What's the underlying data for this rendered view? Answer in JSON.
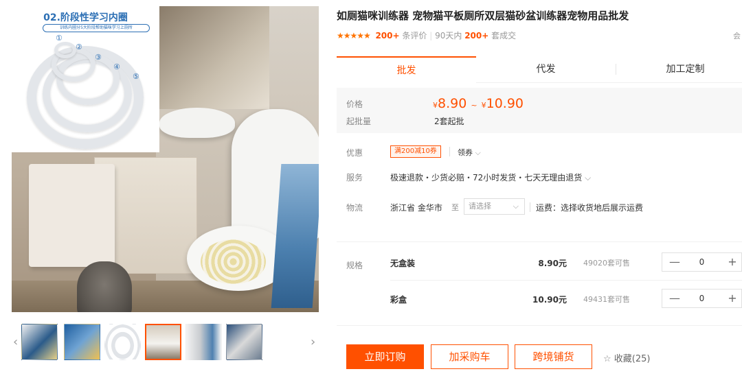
{
  "gallery": {
    "inset_title": "02.阶段性学习内圈",
    "inset_subtitle": "训练内圈分5大阶段帮助猫咪学习上厕所",
    "ring_numbers": [
      "①",
      "②",
      "③",
      "④",
      "⑤"
    ],
    "prev_icon": "‹",
    "next_icon": "›",
    "thumbnail_count": 6,
    "active_thumbnail": 4
  },
  "product": {
    "title": "如厕猫咪训练器 宠物猫平板厕所双层猫砂盆训练器宠物用品批发",
    "stars": "★★★★★",
    "review_count": "200+",
    "review_label": "条评价",
    "sold_period": "90天内",
    "sold_count": "200+",
    "sold_label": "套成交",
    "right_edge": "会"
  },
  "tabs": [
    {
      "label": "批发",
      "active": true
    },
    {
      "label": "代发",
      "active": false
    },
    {
      "label": "加工定制",
      "active": false
    }
  ],
  "price": {
    "label": "价格",
    "currency": "¥",
    "low": "8.90",
    "sep": "~",
    "high": "10.90",
    "moq_label": "起批量",
    "moq_value": "2套起批"
  },
  "promo": {
    "label": "优惠",
    "coupon": "满200减10券",
    "coupon_link": "领券",
    "service_label": "服务",
    "service_text": "极速退款・少货必赔・72小时发货・七天无理由退货",
    "logistics_label": "物流",
    "origin": "浙江省 金华市",
    "to": "至",
    "select_placeholder": "请选择",
    "shipping": "运费：选择收货地后展示运费"
  },
  "specs": {
    "label": "规格",
    "items": [
      {
        "name": "无盒装",
        "price": "8.90元",
        "stock": "49020套可售",
        "qty": "0"
      },
      {
        "name": "彩盒",
        "price": "10.90元",
        "stock": "49431套可售",
        "qty": "0"
      }
    ],
    "minus": "—",
    "plus": "+"
  },
  "actions": {
    "order": "立即订购",
    "cart": "加采购车",
    "crossborder": "跨境铺货",
    "favorite": "收藏(25)",
    "favorite_icon": "☆"
  },
  "colors": {
    "accent": "#ff5000",
    "star": "#ff7300",
    "inset_blue": "#2c6fb4"
  }
}
